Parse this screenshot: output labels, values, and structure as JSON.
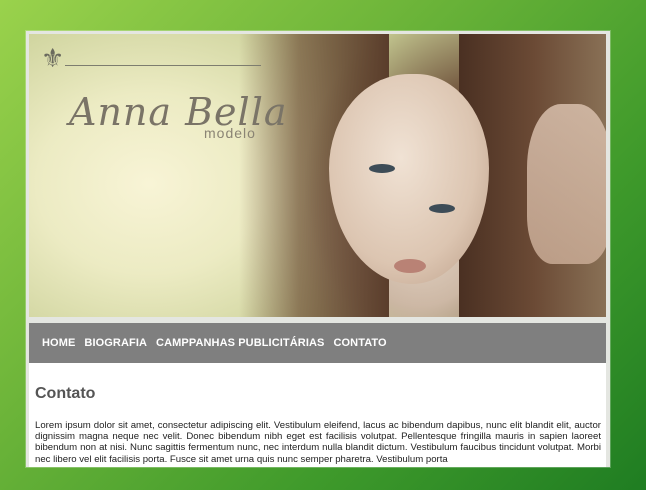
{
  "site": {
    "brand_name": "Anna Bella",
    "brand_subtitle": "modelo",
    "brand_ornament": "⚜"
  },
  "nav": {
    "items": [
      "HOME",
      "BIOGRAFIA",
      "CAMPPANHAS PUBLICITÁRIAS",
      "CONTATO"
    ]
  },
  "page": {
    "title": "Contato",
    "body": "Lorem ipsum dolor sit amet, consectetur adipiscing elit. Vestibulum eleifend, lacus ac bibendum dapibus, nunc elit blandit elit, auctor dignissim magna neque nec velit. Donec bibendum nibh eget est facilisis volutpat. Pellentesque fringilla mauris in sapien laoreet bibendum non at nisi. Nunc sagittis fermentum nunc, nec interdum nulla blandit dictum. Vestibulum faucibus tincidunt volutpat. Morbi nec libero vel elit facilisis porta. Fusce sit amet urna quis nunc semper pharetra. Vestibulum porta"
  },
  "colors": {
    "background_gradient": [
      "#9ad24c",
      "#1f7d22"
    ],
    "nav_bg": "#7f7f7f",
    "nav_text": "#ffffff",
    "title_text": "#555555"
  }
}
